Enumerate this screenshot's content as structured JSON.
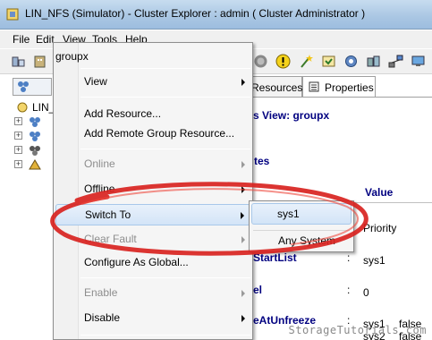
{
  "window": {
    "title": "LIN_NFS (Simulator) - Cluster Explorer : admin ( Cluster Administrator )"
  },
  "menu": [
    "File",
    "Edit",
    "View",
    "Tools",
    "Help"
  ],
  "tree": {
    "root_label": "LIN_"
  },
  "tabs": {
    "resources": "Resources",
    "properties": "Properties"
  },
  "properties_view": {
    "heading": "s View: groupx",
    "section": "tes",
    "value_header": "Value",
    "rows": [
      {
        "key": "",
        "sep": "",
        "value": "Priority"
      },
      {
        "key": "StartList",
        "sep": ":",
        "value": "sys1"
      },
      {
        "key": "el",
        "sep": ":",
        "value": "0"
      },
      {
        "key": "eAtUnfreeze",
        "sep": ":",
        "value": "sys1",
        "extra": "false"
      }
    ],
    "cut_off_value": "sys2",
    "cut_off_extra": "false"
  },
  "context_menu": {
    "header": "groupx",
    "items": [
      {
        "label": "View",
        "submenu": true,
        "disabled": false
      },
      {
        "label": "Add Resource...",
        "submenu": false,
        "disabled": false
      },
      {
        "label": "Add Remote Group Resource...",
        "submenu": false,
        "disabled": false
      },
      {
        "label": "Online",
        "submenu": true,
        "disabled": true
      },
      {
        "label": "Offline",
        "submenu": true,
        "disabled": false
      },
      {
        "label": "Switch To",
        "submenu": true,
        "disabled": false,
        "highlighted": true
      },
      {
        "label": "Clear Fault",
        "submenu": true,
        "disabled": true
      },
      {
        "label": "Configure As Global...",
        "submenu": false,
        "disabled": false
      },
      {
        "label": "Enable",
        "submenu": true,
        "disabled": true
      },
      {
        "label": "Disable",
        "submenu": true,
        "disabled": false
      }
    ]
  },
  "submenu": {
    "items": [
      "sys1",
      "Any System"
    ],
    "highlighted": "sys1"
  },
  "watermark": "StorageTutorials.com",
  "colors": {
    "highlight_ellipse": "#d8231f",
    "menu_highlight": "#d3e4f7",
    "navy_text": "#000080"
  }
}
